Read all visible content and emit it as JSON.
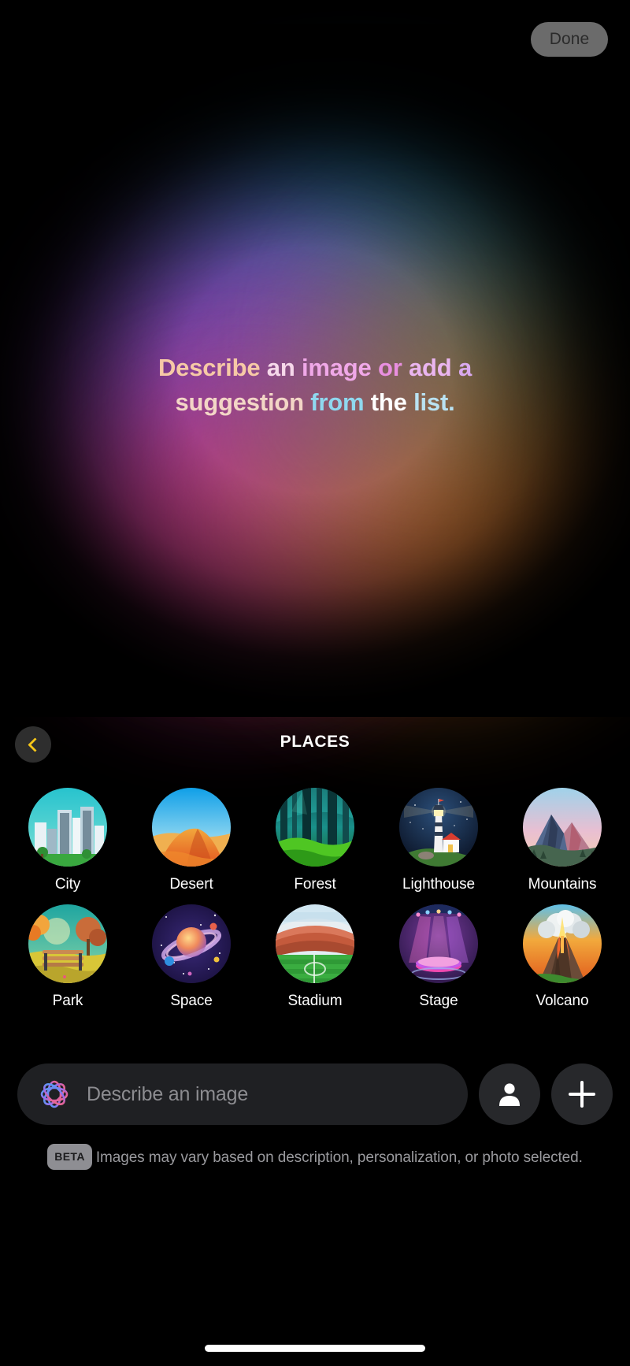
{
  "topbar": {
    "done_label": "Done"
  },
  "headline": {
    "segments": [
      {
        "text": "Describe ",
        "color": "#f6c9a6"
      },
      {
        "text": "an ",
        "color": "#f6d8ea"
      },
      {
        "text": "image ",
        "color": "#f0a8e8"
      },
      {
        "text": "or ",
        "color": "#e98fe0"
      },
      {
        "text": "add ",
        "color": "#eab5ef"
      },
      {
        "text": "a ",
        "color": "#d9a9ef"
      },
      {
        "text": "suggestion ",
        "color": "#f3d6c6"
      },
      {
        "text": "from ",
        "color": "#8fd8ef"
      },
      {
        "text": "the ",
        "color": "#ffffff"
      },
      {
        "text": "list.",
        "color": "#b9e2f2"
      }
    ],
    "full_text": "Describe an image or add a suggestion from the list."
  },
  "category": {
    "title": "PLACES",
    "back_icon": "chevron-left-icon",
    "back_icon_color": "#f5c518"
  },
  "grid": {
    "rows": [
      [
        {
          "label": "City",
          "icon": "city-thumbnail"
        },
        {
          "label": "Desert",
          "icon": "desert-thumbnail"
        },
        {
          "label": "Forest",
          "icon": "forest-thumbnail"
        },
        {
          "label": "Lighthouse",
          "icon": "lighthouse-thumbnail"
        },
        {
          "label": "Mountains",
          "icon": "mountains-thumbnail"
        }
      ],
      [
        {
          "label": "Park",
          "icon": "park-thumbnail"
        },
        {
          "label": "Space",
          "icon": "space-thumbnail"
        },
        {
          "label": "Stadium",
          "icon": "stadium-thumbnail"
        },
        {
          "label": "Stage",
          "icon": "stage-thumbnail"
        },
        {
          "label": "Volcano",
          "icon": "volcano-thumbnail"
        }
      ]
    ]
  },
  "input": {
    "placeholder": "Describe an image",
    "value": "",
    "ai_icon": "apple-intelligence-icon",
    "person_button_icon": "person-icon",
    "add_button_icon": "plus-icon"
  },
  "disclaimer": {
    "badge": "BETA",
    "text": "Images may vary based on description, personalization, or photo selected."
  },
  "colors": {
    "background": "#000000",
    "accent_yellow": "#f5c518",
    "done_pill": "#6b6b6b",
    "field_background": "#1f2023",
    "placeholder_text": "#8c8c90"
  }
}
